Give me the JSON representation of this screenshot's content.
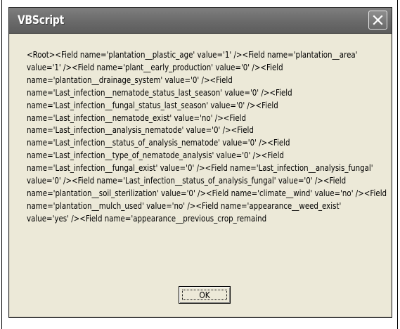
{
  "window": {
    "title": "VBScript",
    "close_icon": "close-x"
  },
  "message": {
    "lines": [
      "<Root><Field name='plantation__plastic_age' value='1' /><Field name='plantation__area'",
      "value='1' /><Field name='plant__early_production' value='0' /><Field",
      "name='plantation__drainage_system' value='0' /><Field",
      "name='Last_infection__nematode_status_last_season' value='0' /><Field",
      "name='Last_infection__fungal_status_last_season' value='0' /><Field",
      "name='Last_infection__nematode_exist' value='no' /><Field",
      "name='Last_infection__analysis_nematode' value='0' /><Field",
      "name='Last_infection__status_of_analysis_nematode' value='0' /><Field",
      "name='Last_infection__type_of_nematode_analysis' value='0' /><Field",
      "name='Last_infection__fungal_exist' value='0' /><Field name='Last_infection__analysis_fungal'",
      "value='0' /><Field name='Last_infection__status_of_analysis_fungal' value='0' /><Field",
      "name='plantation__soil_sterilization' value='0' /><Field name='climate__wind' value='no' /><Field",
      "name='plantation__mulch_used' value='no' /><Field name='appearance__weed_exist'",
      "value='yes' /><Field name='appearance__previous_crop_remaind"
    ]
  },
  "buttons": {
    "ok_label": "OK"
  }
}
